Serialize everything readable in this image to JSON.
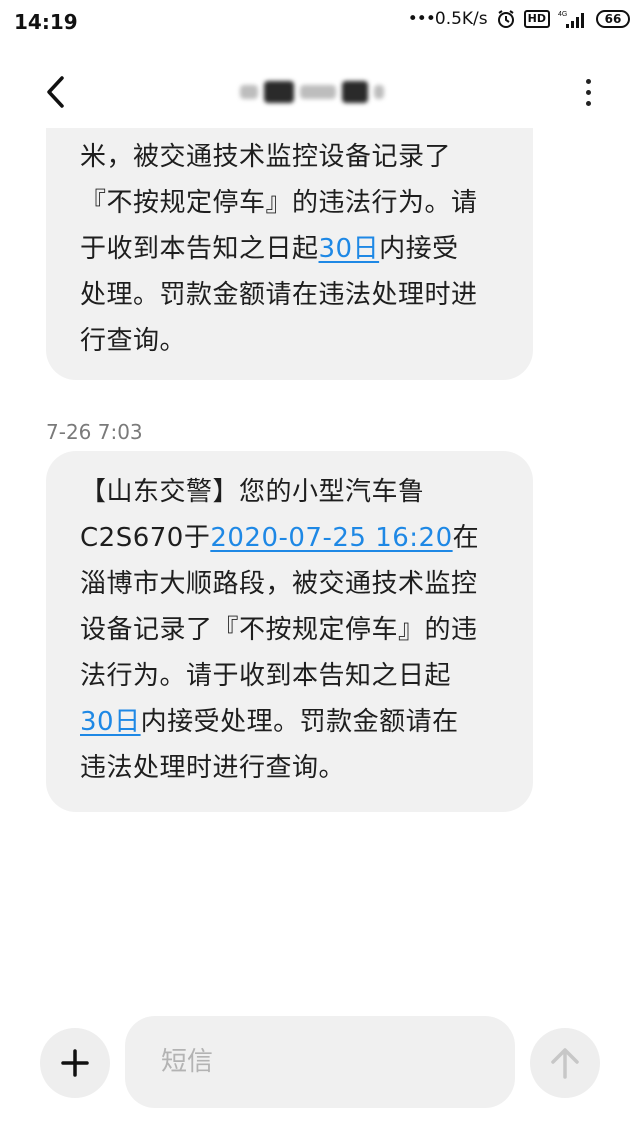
{
  "status_bar": {
    "time": "14:19",
    "speed": "0.5K/s",
    "hd": "HD",
    "network": "4G",
    "battery": "66"
  },
  "header": {
    "back_icon": "chevron-left-icon",
    "more_icon": "more-vertical-icon"
  },
  "messages": [
    {
      "lines": [
        [
          "米，被交通技术监控设备记录了"
        ],
        [
          "『不按规定停车』的违法行为。请"
        ],
        [
          "于收到本告知之日起",
          "30日",
          "内接受"
        ],
        [
          "处理。罚款金额请在违法处理时进"
        ],
        [
          "行查询。"
        ]
      ]
    },
    {
      "timestamp": "7-26 7:03",
      "lines": [
        [
          "【山东交警】您的小型汽车鲁"
        ],
        [
          "C2S670于",
          "2020-07-25 16:20",
          "在"
        ],
        [
          "淄博市大顺路段，被交通技术监控"
        ],
        [
          "设备记录了『不按规定停车』的违"
        ],
        [
          "法行为。请于收到本告知之日起"
        ],
        [
          "30日",
          "内接受处理。罚款金额请在"
        ],
        [
          "违法处理时进行查询。"
        ]
      ]
    }
  ],
  "composer": {
    "placeholder": "短信",
    "add_icon": "plus-icon",
    "send_icon": "arrow-up-icon"
  },
  "colors": {
    "link": "#1e88e5",
    "bubble": "#f1f1f1",
    "background": "#ffffff"
  }
}
